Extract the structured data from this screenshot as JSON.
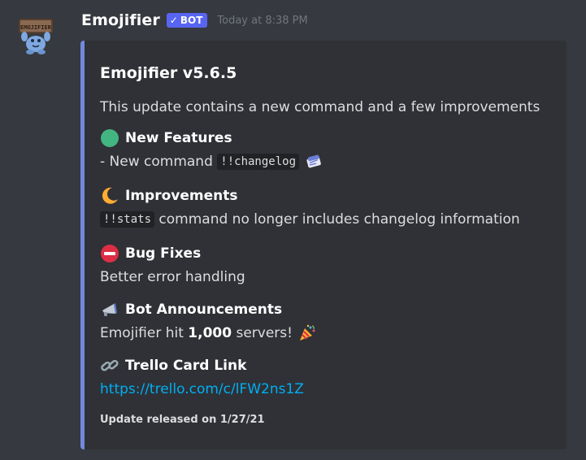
{
  "message": {
    "username": "Emojifier",
    "bot_tag": "BOT",
    "bot_check": "✓",
    "timestamp": "Today at 8:38 PM",
    "avatar_sign": "EMOJIFIER"
  },
  "embed": {
    "accent_color": "#7289da",
    "title": "Emojifier v5.6.5",
    "description": "This update contains a new command and a few improvements",
    "fields": [
      {
        "icon": "green-circle-icon",
        "name": "New Features",
        "value_prefix": "- New command ",
        "value_code": "!!changelog",
        "value_icon": "scroll-icon"
      },
      {
        "icon": "crescent-moon-icon",
        "name": "Improvements",
        "value_code": "!!stats",
        "value_suffix": " command no longer includes changelog information"
      },
      {
        "icon": "no-entry-icon",
        "name": "Bug Fixes",
        "value": "Better error handling"
      },
      {
        "icon": "megaphone-icon",
        "name": "Bot Announcements",
        "value_prefix": "Emojifier hit ",
        "value_bold": "1,000",
        "value_suffix": " servers!",
        "value_icon": "party-popper-icon"
      },
      {
        "icon": "link-icon",
        "name": "Trello Card Link",
        "value_link": "https://trello.com/c/lFW2ns1Z"
      }
    ],
    "footer": "Update released on 1/27/21"
  }
}
